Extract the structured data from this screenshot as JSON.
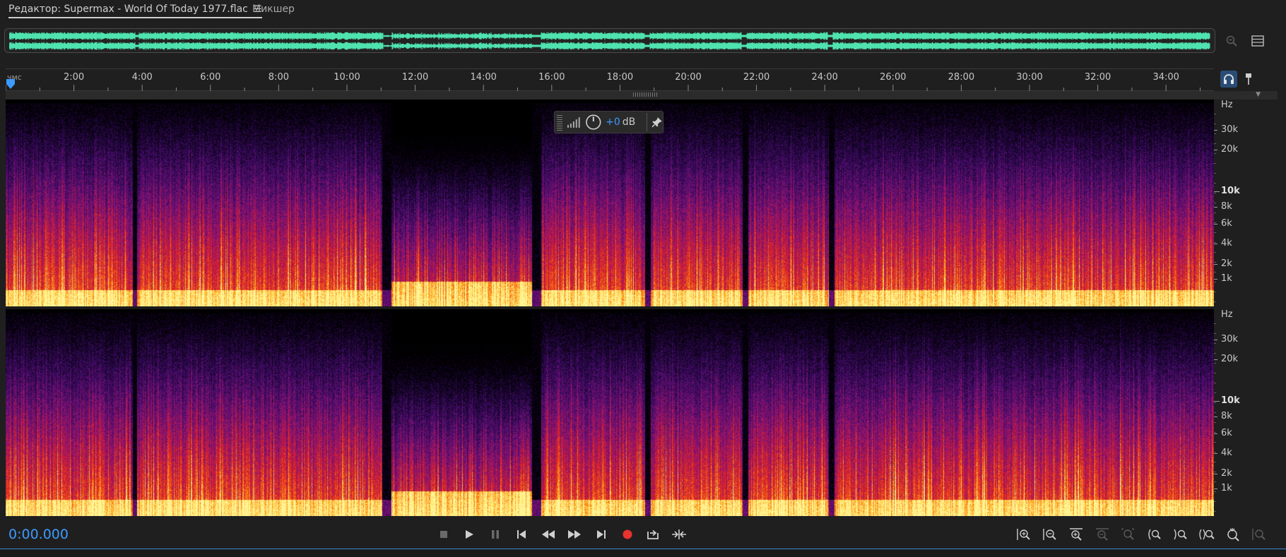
{
  "tabs": {
    "editor_label": "Редактор: Supermax - World Of Today 1977.flac",
    "mixer_label": "Микшер"
  },
  "ruler": {
    "unit": "чмс",
    "labels": [
      "2:00",
      "4:00",
      "6:00",
      "8:00",
      "10:00",
      "12:00",
      "14:00",
      "16:00",
      "18:00",
      "20:00",
      "22:00",
      "24:00",
      "26:00",
      "28:00",
      "30:00",
      "32:00",
      "34:00"
    ]
  },
  "hud": {
    "value": "+0",
    "unit": "dB"
  },
  "frequency_axis": {
    "unit": "Hz",
    "labels": [
      "30k",
      "20k",
      "10k",
      "8k",
      "6k",
      "4k",
      "2k",
      "1k"
    ]
  },
  "transport": {
    "current_time": "0:00.000"
  },
  "icons": {
    "stop": "stop-icon",
    "play": "play-icon",
    "pause": "pause-icon",
    "to_start": "skip-to-start-icon",
    "rewind": "rewind-icon",
    "fast_forward": "fast-forward-icon",
    "to_end": "skip-to-end-icon",
    "record": "record-icon",
    "loop": "loop-playback-icon",
    "skip_selection": "skip-selection-icon"
  },
  "colors": {
    "accent_blue": "#3d9bff",
    "waveform_green": "#4fe3b0",
    "record_red": "#e8332e"
  }
}
